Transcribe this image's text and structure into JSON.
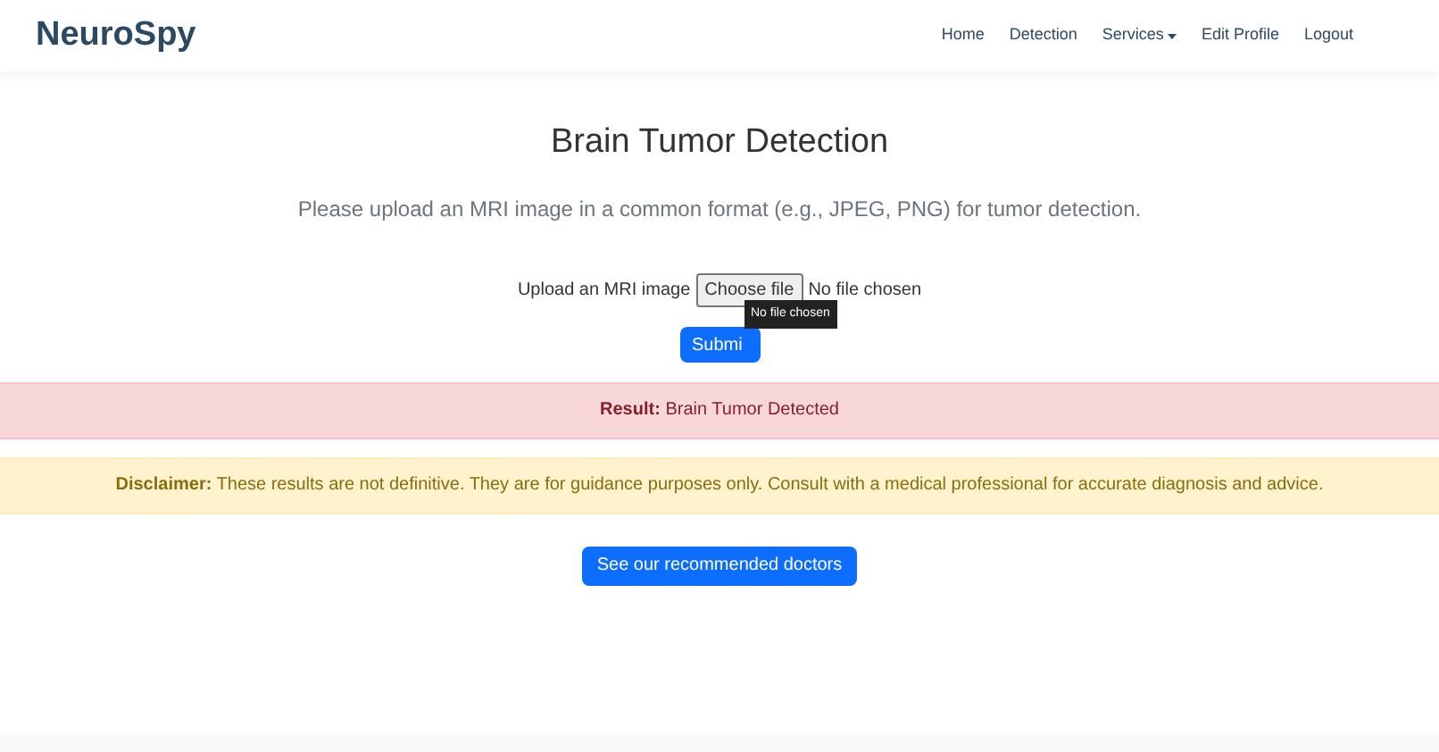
{
  "navbar": {
    "brand": "NeuroSpy",
    "links": [
      {
        "label": "Home",
        "kind": "link"
      },
      {
        "label": "Detection",
        "kind": "link"
      },
      {
        "label": "Services",
        "kind": "dropdown"
      },
      {
        "label": "Edit Profile",
        "kind": "link"
      },
      {
        "label": "Logout",
        "kind": "link"
      }
    ]
  },
  "heading": "Brain Tumor Detection",
  "subtitle": "Please upload an MRI image in a common format (e.g., JPEG, PNG) for tumor detection.",
  "upload": {
    "label": "Upload an MRI image",
    "button": "Choose file",
    "status": "No file chosen",
    "tooltip": "No file chosen"
  },
  "submit_button": "Submi",
  "result": "**Result:** Brain Tumor Detected",
  "disclaimer": "**Disclaimer:** These results are not definitive. They are for guidance purposes only. Consult with a medical professional for accurate diagnosis and advice.",
  "doctors_button": "See our recommended doctors"
}
